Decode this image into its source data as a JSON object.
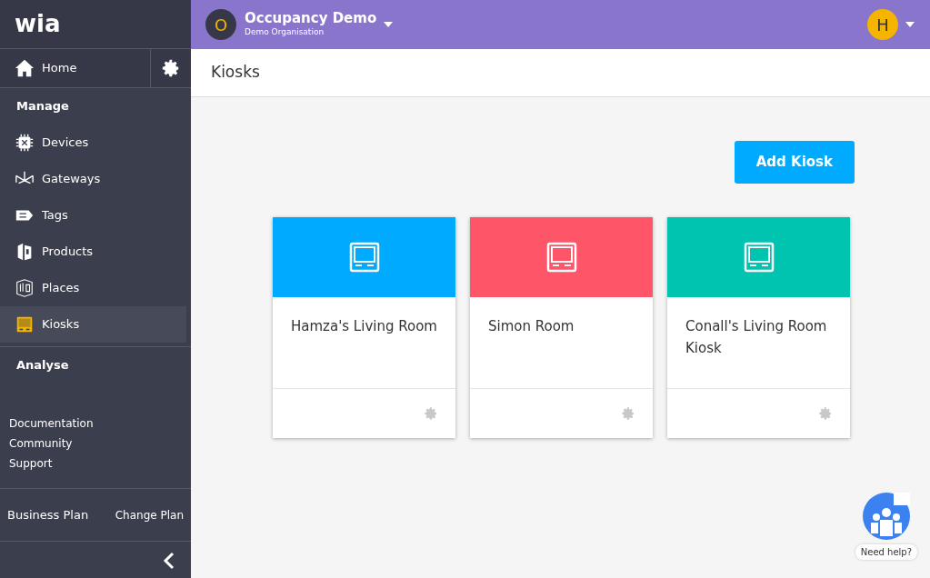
{
  "sidebar": {
    "logo": "wia",
    "home": "Home",
    "sections": [
      {
        "title": "Manage",
        "items": [
          {
            "label": "Devices",
            "selected": false
          },
          {
            "label": "Gateways",
            "selected": false
          },
          {
            "label": "Tags",
            "selected": false
          },
          {
            "label": "Products",
            "selected": false
          },
          {
            "label": "Places",
            "selected": false
          },
          {
            "label": "Kiosks",
            "selected": true
          }
        ]
      },
      {
        "title": "Analyse"
      }
    ],
    "links": [
      "Documentation",
      "Community",
      "Support"
    ],
    "plan": "Business Plan",
    "change_plan": "Change Plan"
  },
  "topbar": {
    "org_initial": "O",
    "space": "Occupancy Demo",
    "organisation": "Demo Organisation",
    "user_initial": "H"
  },
  "page_title": "Kiosks",
  "add_button": "Add Kiosk",
  "kiosks": [
    {
      "name": "Hamza's Living Room",
      "color": "#00aaff"
    },
    {
      "name": "Simon Room",
      "color": "#ff5568"
    },
    {
      "name": "Conall's Living Room Kiosk",
      "color": "#00c4b0"
    }
  ],
  "help": "Need help?"
}
